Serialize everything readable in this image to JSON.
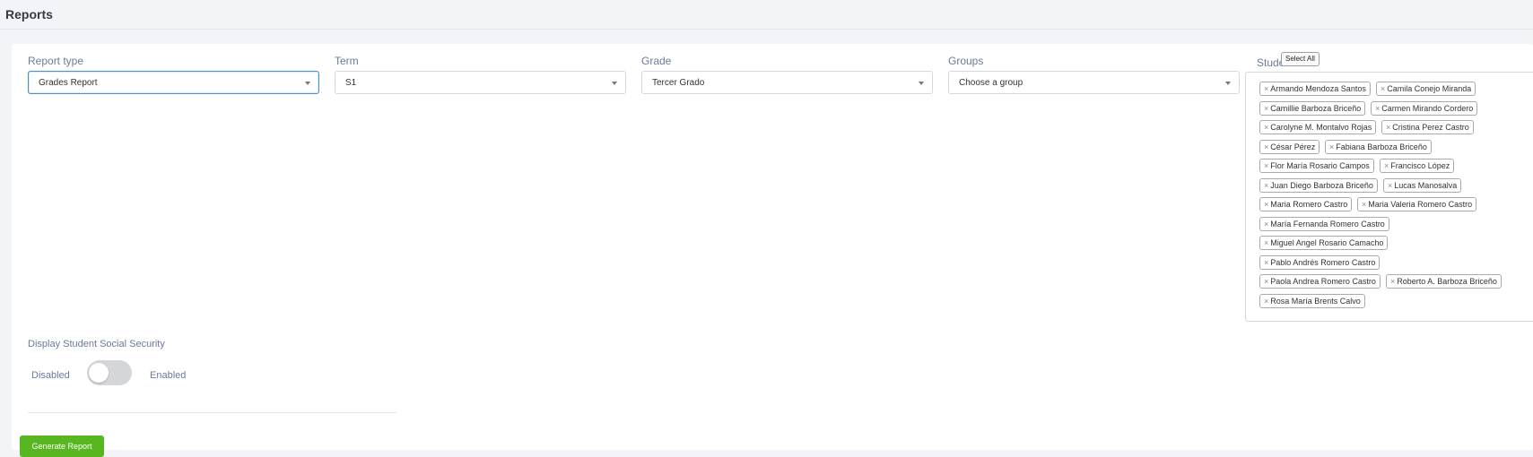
{
  "page": {
    "title": "Reports"
  },
  "filters": {
    "report_type": {
      "label": "Report type",
      "value": "Grades Report"
    },
    "term": {
      "label": "Term",
      "value": "S1"
    },
    "grade": {
      "label": "Grade",
      "value": "Tercer Grado"
    },
    "groups": {
      "label": "Groups",
      "placeholder": "Choose a group"
    }
  },
  "students": {
    "label": "Student",
    "select_all_label": "Select All",
    "remove_symbol": "×",
    "selected": [
      "Armando Mendoza Santos",
      "Camila Conejo Miranda",
      "Camillie Barboza Briceño",
      "Carmen Mirando Cordero",
      "Carolyne M. Montalvo Rojas",
      "Cristina Perez Castro",
      "César Pérez",
      "Fabiana Barboza Briceño",
      "Flor María Rosario Campos",
      "Francisco López",
      "Juan Diego Barboza Briceño",
      "Lucas Manosalva",
      "Maria Romero Castro",
      "Maria Valeria Romero Castro",
      "María Fernanda Romero Castro",
      "Miguel Angel Rosario Camacho",
      "Pablo Andrés Romero Castro",
      "Paola Andrea Romero Castro",
      "Roberto A. Barboza Briceño",
      "Rosa María Brents Calvo"
    ]
  },
  "ssn": {
    "label": "Display Student Social Security",
    "off_label": "Disabled",
    "on_label": "Enabled",
    "enabled": false
  },
  "actions": {
    "generate_label": "Generate Report"
  },
  "colors": {
    "accent_green": "#58b720",
    "focus_blue": "#4a90d9"
  }
}
